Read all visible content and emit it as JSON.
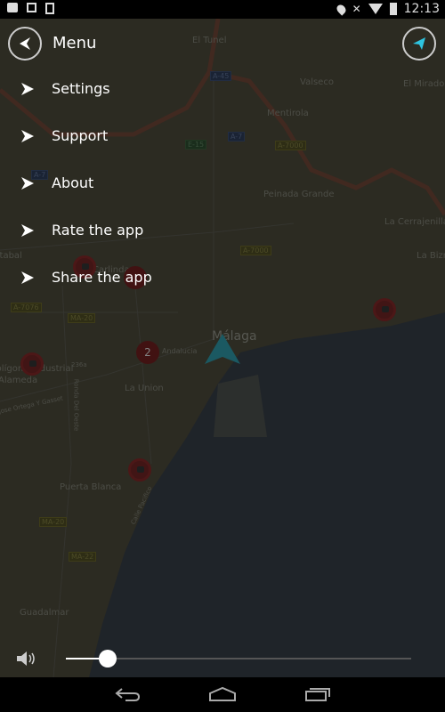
{
  "status_bar": {
    "time": "12:13",
    "icons": [
      "notification-icon",
      "image-icon",
      "alert-icon",
      "location-icon",
      "mute-icon",
      "wifi-icon",
      "battery-icon"
    ]
  },
  "header": {
    "title": "Menu",
    "back_icon": "back-arrow-icon",
    "locate_icon": "navigation-arrow-icon",
    "accent": "#2ec4e0"
  },
  "menu": {
    "items": [
      {
        "label": "Settings"
      },
      {
        "label": "Support"
      },
      {
        "label": "About"
      },
      {
        "label": "Rate the app"
      },
      {
        "label": "Share the app"
      }
    ]
  },
  "map": {
    "labels": [
      "El Tunel",
      "Valseco",
      "El Mirador",
      "Mentirola",
      "Peinada Grande",
      "La Cerrajenilla",
      "La Bizn",
      "Estabal",
      "Carlinda",
      "Málaga",
      "Andalucia",
      "La Union",
      "Polígono Industrial",
      "Alameda",
      "Jose Ortega Y Gasset",
      "Ronda Del Oeste",
      "Puerta Blanca",
      "Calle Pacifico",
      "Guadalmar",
      "236a"
    ],
    "roads": [
      "A-45",
      "A-7",
      "E-15",
      "A-7000",
      "A-7",
      "A-7000",
      "A-7076",
      "MA-20",
      "MA-20",
      "MA-22"
    ],
    "cluster_count": "2"
  },
  "volume": {
    "level_percent": 12,
    "icon": "speaker-icon"
  },
  "nav_bar": {
    "buttons": [
      "back",
      "home",
      "recents"
    ]
  }
}
